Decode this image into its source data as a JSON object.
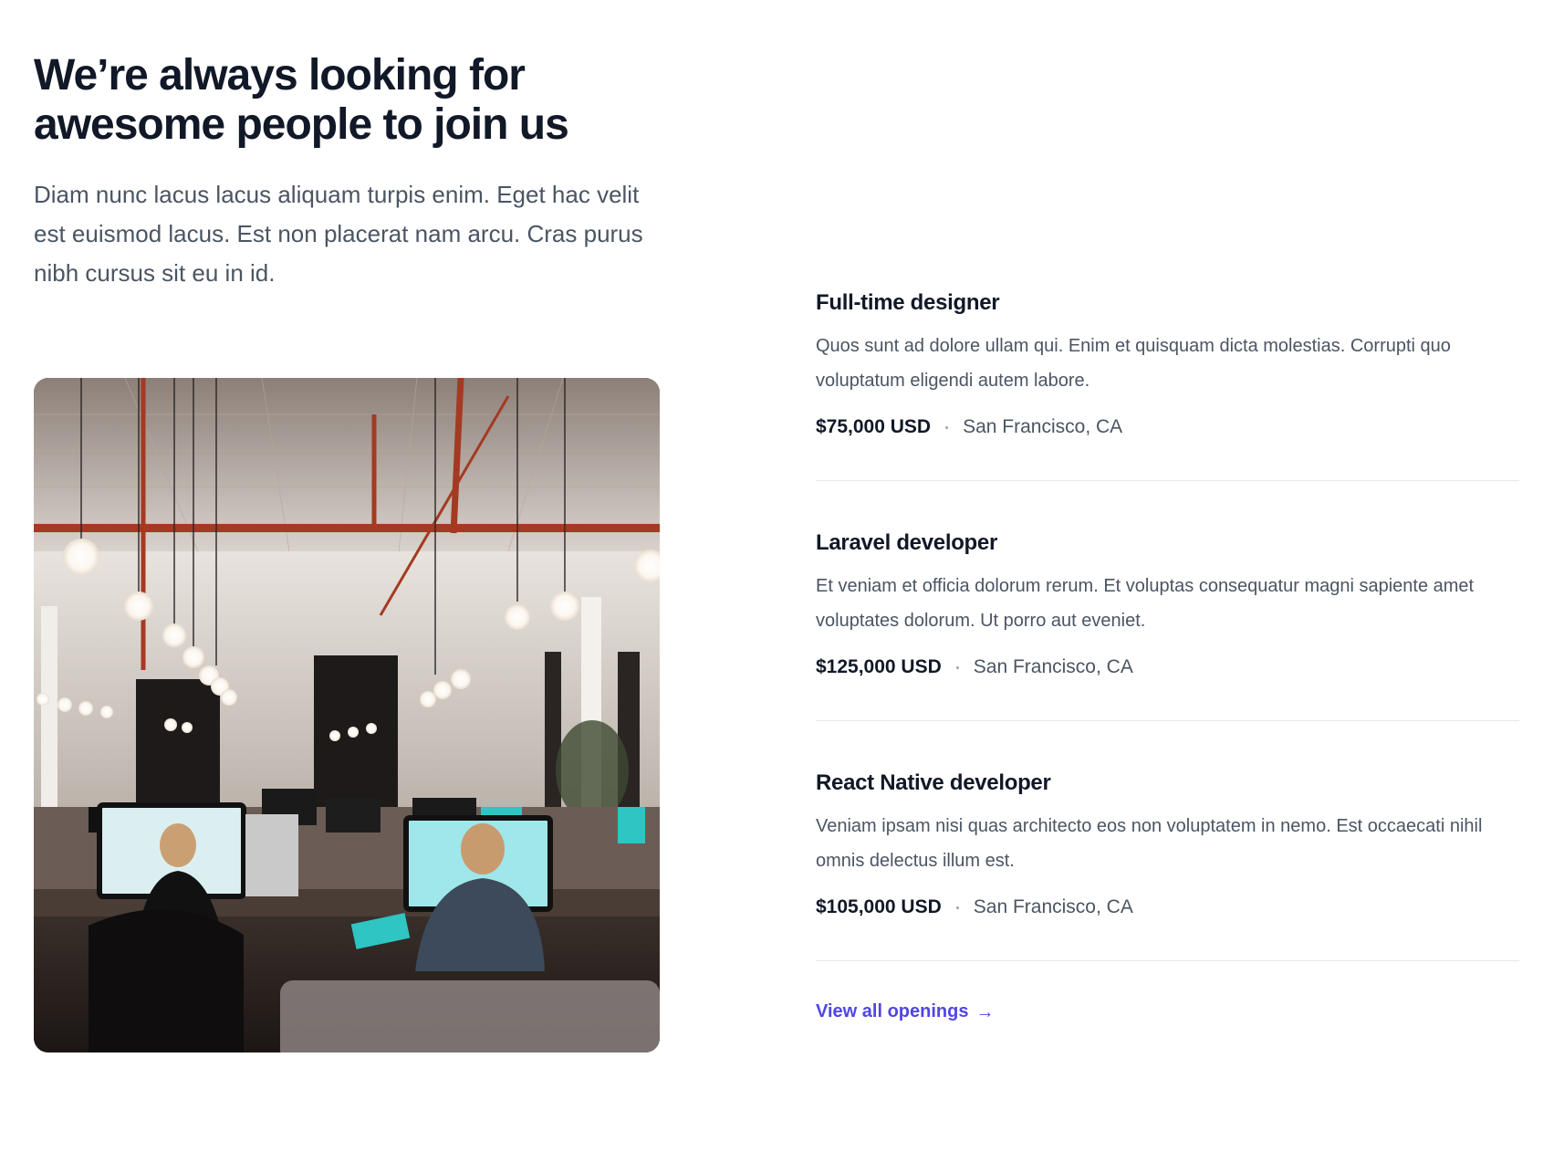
{
  "hero": {
    "heading": "We’re always looking for awesome people to join us",
    "lead": "Diam nunc lacus lacus aliquam turpis enim. Eget hac velit est euismod lacus. Est non placerat nam arcu. Cras purus nibh cursus sit eu in id."
  },
  "jobs": [
    {
      "title": "Full-time designer",
      "description": "Quos sunt ad dolore ullam qui. Enim et quisquam dicta molestias. Corrupti quo voluptatum eligendi autem labore.",
      "salary": "$75,000 USD",
      "location": "San Francisco, CA"
    },
    {
      "title": "Laravel developer",
      "description": "Et veniam et officia dolorum rerum. Et voluptas consequatur magni sapiente amet voluptates dolorum. Ut porro aut eveniet.",
      "salary": "$125,000 USD",
      "location": "San Francisco, CA"
    },
    {
      "title": "React Native developer",
      "description": "Veniam ipsam nisi quas architecto eos non voluptatem in nemo. Est occaecati nihil omnis delectus illum est.",
      "salary": "$105,000 USD",
      "location": "San Francisco, CA"
    }
  ],
  "cta": {
    "label": "View all openings",
    "arrow": "→"
  },
  "colors": {
    "heading": "#111827",
    "body": "#4b5563",
    "accent": "#4f46e5",
    "divider": "#e5e7eb"
  },
  "icons": {
    "cta_arrow": "arrow-right-icon"
  }
}
